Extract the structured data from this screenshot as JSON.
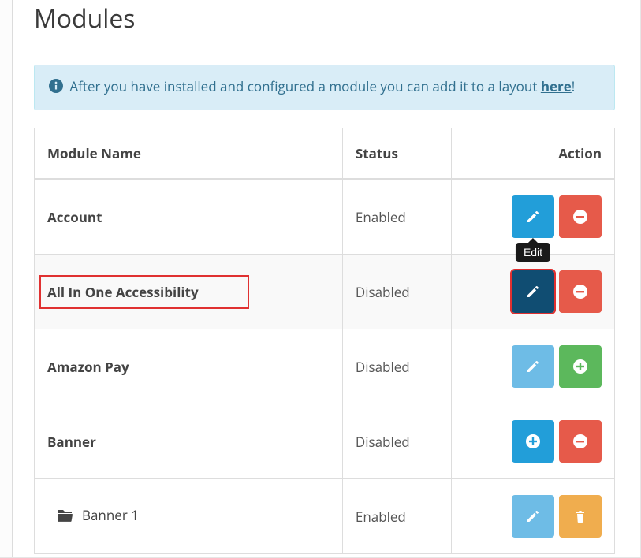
{
  "page": {
    "title": "Modules"
  },
  "alert": {
    "text_before": "After you have installed and configured a module you can add it to a layout ",
    "link_text": "here",
    "text_after": "!"
  },
  "table": {
    "headers": {
      "name": "Module Name",
      "status": "Status",
      "action": "Action"
    },
    "rows": [
      {
        "name": "Account",
        "status": "Enabled",
        "sub": false,
        "highlight": false,
        "name_boxed": false,
        "actions": [
          {
            "key": "edit",
            "color": "blue",
            "icon": "pencil",
            "tooltip": "Edit",
            "redring": false
          },
          {
            "key": "uninstall",
            "color": "red",
            "icon": "minus",
            "tooltip": null,
            "redring": false
          }
        ]
      },
      {
        "name": "All In One Accessibility",
        "status": "Disabled",
        "sub": false,
        "highlight": true,
        "name_boxed": true,
        "actions": [
          {
            "key": "edit",
            "color": "blue-dark",
            "icon": "pencil",
            "tooltip": null,
            "redring": true
          },
          {
            "key": "uninstall",
            "color": "red",
            "icon": "minus",
            "tooltip": null,
            "redring": false
          }
        ]
      },
      {
        "name": "Amazon Pay",
        "status": "Disabled",
        "sub": false,
        "highlight": false,
        "name_boxed": false,
        "actions": [
          {
            "key": "edit",
            "color": "blue-light",
            "icon": "pencil",
            "tooltip": null,
            "redring": false
          },
          {
            "key": "install",
            "color": "green",
            "icon": "plus",
            "tooltip": null,
            "redring": false
          }
        ]
      },
      {
        "name": "Banner",
        "status": "Disabled",
        "sub": false,
        "highlight": false,
        "name_boxed": false,
        "actions": [
          {
            "key": "add",
            "color": "blue",
            "icon": "plus",
            "tooltip": null,
            "redring": false
          },
          {
            "key": "uninstall",
            "color": "red",
            "icon": "minus",
            "tooltip": null,
            "redring": false
          }
        ]
      },
      {
        "name": "Banner 1",
        "status": "Enabled",
        "sub": true,
        "highlight": false,
        "name_boxed": false,
        "actions": [
          {
            "key": "edit",
            "color": "blue-light",
            "icon": "pencil",
            "tooltip": null,
            "redring": false
          },
          {
            "key": "delete",
            "color": "orange",
            "icon": "trash",
            "tooltip": null,
            "redring": false
          }
        ]
      }
    ]
  }
}
